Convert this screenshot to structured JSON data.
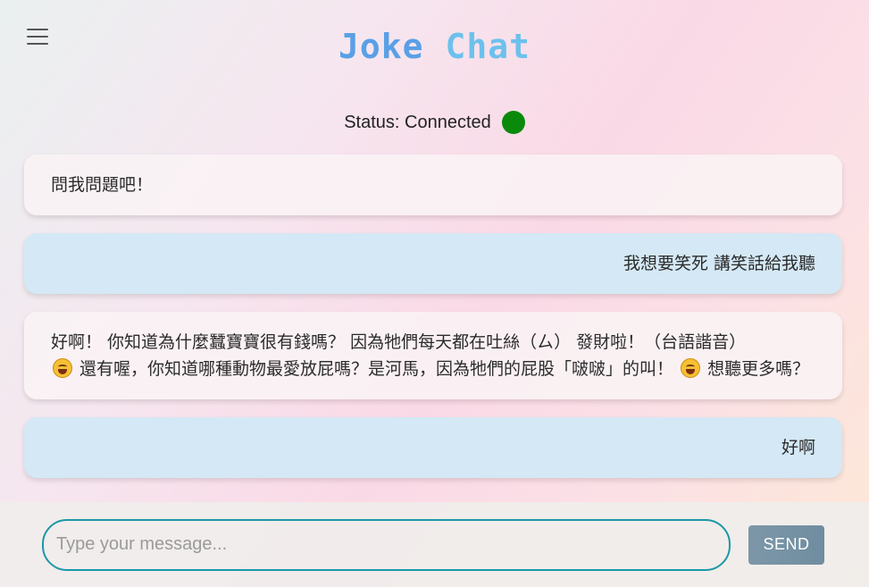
{
  "header": {
    "menu_icon": "hamburger-menu-icon",
    "title_part1": "Joke",
    "title_part2": "Chat"
  },
  "status": {
    "label": "Status: Connected",
    "indicator_color": "#0a8a0a"
  },
  "messages": [
    {
      "role": "bot",
      "text": "問我問題吧！"
    },
    {
      "role": "user",
      "text": "我想要笑死 講笑話給我聽"
    },
    {
      "role": "bot",
      "text_part1": "好啊！ 你知道為什麼蠶寶寶很有錢嗎？ 因為牠們每天都在吐絲（ㄙ） 發財啦！（台語諧音）",
      "emoji1": "rolling-on-floor-laughing-emoji",
      "text_part2": " 還有喔，你知道哪種動物最愛放屁嗎？是河馬，因為牠們的屁股「啵啵」的叫！ ",
      "emoji2": "grinning-squinting-face-emoji",
      "text_part3": " 想聽更多嗎？"
    },
    {
      "role": "user",
      "text": "好啊"
    }
  ],
  "composer": {
    "placeholder": "Type your message...",
    "value": "",
    "send_label": "SEND"
  },
  "colors": {
    "title_blue": "#5aa0e6",
    "title_light_blue": "#6cc1ec",
    "user_bubble": "#d4e8f5",
    "input_border": "#1a98a8",
    "send_button": "#7590a3"
  }
}
